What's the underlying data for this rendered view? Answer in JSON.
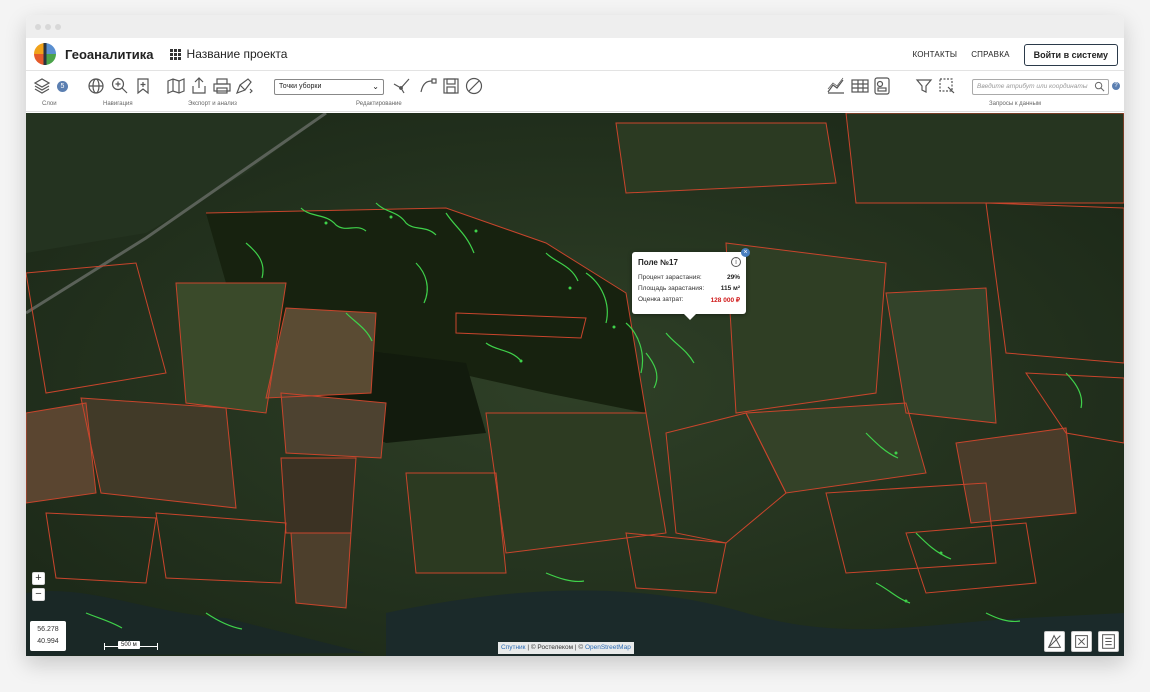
{
  "header": {
    "brand": "Геоаналитика",
    "project_name": "Название проекта",
    "nav_contacts": "КОНТАКТЫ",
    "nav_help": "СПРАВКА",
    "login_label": "Войти в систему"
  },
  "toolbar": {
    "groups": {
      "layers": "Слои",
      "navigation": "Навигация",
      "export": "Экспорт и анализ",
      "editing": "Редактирование",
      "queries": "Запросы к данным"
    },
    "layers_badge": "5",
    "select_value": "Точки уборки",
    "search_placeholder": "Введите атрибут или координаты"
  },
  "popup": {
    "title": "Поле №17",
    "rows": [
      {
        "label": "Процент зарастания:",
        "value": "29%"
      },
      {
        "label": "Площадь зарастания:",
        "value": "115 м²"
      },
      {
        "label": "Оценка затрат:",
        "value": "128 000 ₽"
      }
    ]
  },
  "map": {
    "coord_lat": "56.278",
    "coord_lon": "40.994",
    "scale_label": "500 м",
    "attribution": {
      "sputnik": "Спутник",
      "sep1": " | © Ростелеком | © ",
      "osm": "OpenStreetMap"
    },
    "colors": {
      "field_boundary": "#c8452c",
      "overgrowth": "#3fd14a",
      "cost_value": "#d01818",
      "accent": "#4a80c0"
    }
  }
}
